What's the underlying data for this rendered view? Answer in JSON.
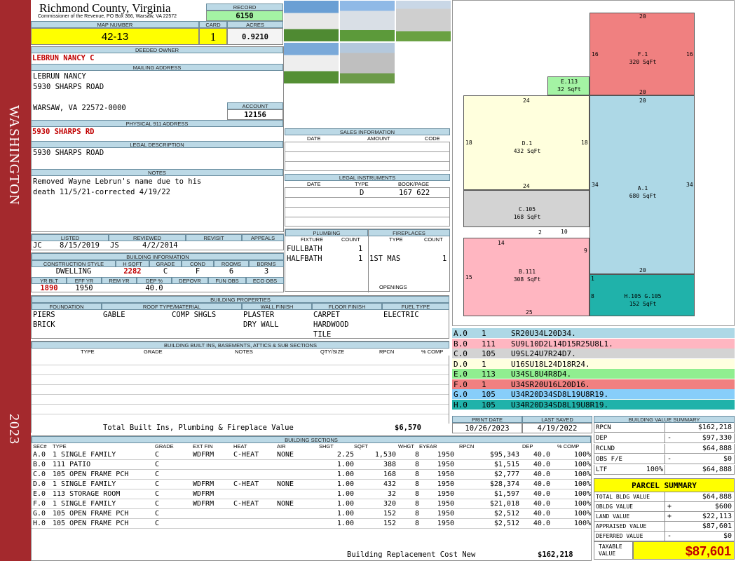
{
  "sidebar": {
    "district": "WASHINGTON",
    "year": "2023"
  },
  "header": {
    "county": "Richmond County, Virginia",
    "commissioner": "Commissioner of the Revenue, PO Box 366, Warsaw, VA 22572",
    "record_label": "RECORD",
    "record": "6150",
    "map_label": "MAP NUMBER",
    "map_number": "42-13",
    "card_label": "CARD",
    "card": "1",
    "acres_label": "ACRES",
    "acres": "0.9210"
  },
  "owner": {
    "deeded_label": "DEEDED OWNER",
    "deeded_owner": "LEBRUN NANCY C",
    "mailing_label": "MAILING ADDRESS",
    "mail_line1": "LEBRUN NANCY",
    "mail_line2": "5930 SHARPS ROAD",
    "mail_line3": "WARSAW, VA 22572-0000",
    "account_label": "ACCOUNT",
    "account": "12156",
    "physical_label": "PHYSICAL 911 ADDRESS",
    "physical": "5930 SHARPS RD",
    "legal_label": "LEGAL DESCRIPTION",
    "legal": "5930 SHARPS ROAD",
    "notes_label": "NOTES",
    "notes1": "Removed Wayne Lebrun's name due to his",
    "notes2": "death 11/5/21-corrected 4/19/22"
  },
  "sales": {
    "label": "SALES INFORMATION",
    "cols": [
      "DATE",
      "AMOUNT",
      "CODE"
    ]
  },
  "legal_instruments": {
    "label": "LEGAL INSTRUMENTS",
    "cols": [
      "DATE",
      "TYPE",
      "BOOK/PAGE"
    ],
    "type": "D",
    "bookpage": "167 622"
  },
  "listing": {
    "listed_label": "LISTED",
    "reviewed_label": "REVIEWED",
    "revisit_label": "REVISIT",
    "appeals_label": "APPEALS",
    "listed_by": "JC",
    "listed_date": "8/15/2019",
    "reviewed_by": "JS",
    "reviewed_date": "4/2/2014"
  },
  "building_info": {
    "label": "BUILDING INFORMATION",
    "cols": [
      "CONSTRUCTION STYLE",
      "H SQFT",
      "GRADE",
      "COND",
      "ROOMS",
      "BDRMS"
    ],
    "style": "DWELLING",
    "hsqft": "2282",
    "grade": "C",
    "cond": "F",
    "rooms": "6",
    "bdrms": "3",
    "cols2": [
      "YR BLT",
      "EFF YR",
      "REM YR",
      "DEP %",
      "DEPOVR",
      "FUN OBS",
      "ECO OBS"
    ],
    "yr_blt": "1890",
    "eff_yr": "1950",
    "dep": "40.0"
  },
  "plumbing": {
    "label": "PLUMBING",
    "cols": [
      "FIXTURE",
      "COUNT"
    ],
    "rows": [
      [
        "FULLBATH",
        "1"
      ],
      [
        "HALFBATH",
        "1"
      ]
    ]
  },
  "fireplaces": {
    "label": "FIREPLACES",
    "cols": [
      "TYPE",
      "COUNT"
    ],
    "rows": [
      [
        "1ST MAS",
        "1"
      ]
    ],
    "openings_label": "OPENINGS"
  },
  "properties": {
    "label": "BUILDING PROPERTIES",
    "foundation_label": "FOUNDATION",
    "roof_label": "ROOF TYPE/MATERIAL",
    "wall_label": "WALL FINISH",
    "floor_label": "FLOOR FINISH",
    "fuel_label": "FUEL TYPE",
    "foundation": [
      "PIERS",
      "BRICK"
    ],
    "roof_type": "GABLE",
    "roof_mat": "COMP SHGLS",
    "wall": [
      "PLASTER",
      "DRY WALL"
    ],
    "floor": [
      "CARPET",
      "HARDWOOD",
      "TILE"
    ],
    "fuel": "ELECTRIC"
  },
  "builtins": {
    "label": "BUILDING BUILT INS, BASEMENTS, ATTICS & SUB SECTIONS",
    "cols": [
      "TYPE",
      "GRADE",
      "NOTES",
      "QTY/SIZE",
      "RPCN",
      "% COMP"
    ],
    "total_label": "Total Built Ins, Plumbing & Fireplace Value",
    "total": "$6,570"
  },
  "print": {
    "print_label": "PRINT DATE",
    "saved_label": "LAST SAVED",
    "print_date": "10/26/2023",
    "last_saved": "4/19/2022"
  },
  "sketch": {
    "segments": [
      {
        "id": "F.1",
        "area": "320 SqFt",
        "color": "#f08080"
      },
      {
        "id": "E.113",
        "area": "32 SqFt",
        "color": "#a4f3a4"
      },
      {
        "id": "D.1",
        "area": "432 SqFt",
        "color": "#ffffdd"
      },
      {
        "id": "A.1",
        "area": "680 SqFt",
        "color": "#add8e6"
      },
      {
        "id": "C.105",
        "area": "168 SqFt",
        "color": "#d3d3d3"
      },
      {
        "id": "B.111",
        "area": "308 SqFt",
        "color": "#ffb6c1"
      },
      {
        "id": "H.105 G.105",
        "area": "152 SqFt",
        "color": "#20b2aa"
      }
    ],
    "dims": [
      "20",
      "16",
      "16",
      "20",
      "24",
      "20",
      "18",
      "18",
      "24",
      "34",
      "34",
      "2",
      "10",
      "14",
      "9",
      "20",
      "15",
      "1",
      "8",
      "25"
    ]
  },
  "codes": [
    {
      "sec": "A.0",
      "code": "1",
      "path": "SR20U34L20D34.",
      "color": "#add8e6"
    },
    {
      "sec": "B.0",
      "code": "111",
      "path": "SU9L10D2L14D15R25U8L1.",
      "color": "#ffb6c1"
    },
    {
      "sec": "C.0",
      "code": "105",
      "path": "U9SL24U7R24D7.",
      "color": "#d3d3d3"
    },
    {
      "sec": "D.0",
      "code": "1",
      "path": "U16SU18L24D18R24.",
      "color": "#ffffe0"
    },
    {
      "sec": "E.0",
      "code": "113",
      "path": "U34SL8U4R8D4.",
      "color": "#90ee90"
    },
    {
      "sec": "F.0",
      "code": "1",
      "path": "U34SR20U16L20D16.",
      "color": "#f08080"
    },
    {
      "sec": "G.0",
      "code": "105",
      "path": "U34R20D34SD8L19U8R19.",
      "color": "#87cefa"
    },
    {
      "sec": "H.0",
      "code": "105",
      "path": "U34R20D34SD8L19U8R19.",
      "color": "#20b2aa"
    }
  ],
  "sections": {
    "label": "BUILDING SECTIONS",
    "cols": [
      "SEC#",
      "TYPE",
      "GRADE",
      "EXT FIN",
      "HEAT",
      "AIR",
      "SHGT",
      "SQFT",
      "WHGT",
      "EYEAR",
      "RPCN",
      "DEP",
      "% COMP"
    ],
    "rows": [
      [
        "A.0",
        "1 SINGLE FAMILY",
        "C",
        "WDFRM",
        "C-HEAT",
        "NONE",
        "2.25",
        "1,530",
        "8",
        "1950",
        "$95,343",
        "40.0",
        "100%"
      ],
      [
        "B.0",
        "111 PATIO",
        "C",
        "",
        "",
        "",
        "1.00",
        "388",
        "8",
        "1950",
        "$1,515",
        "40.0",
        "100%"
      ],
      [
        "C.0",
        "105 OPEN FRAME PCH",
        "C",
        "",
        "",
        "",
        "1.00",
        "168",
        "8",
        "1950",
        "$2,777",
        "40.0",
        "100%"
      ],
      [
        "D.0",
        "1 SINGLE FAMILY",
        "C",
        "WDFRM",
        "C-HEAT",
        "NONE",
        "1.00",
        "432",
        "8",
        "1950",
        "$28,374",
        "40.0",
        "100%"
      ],
      [
        "E.0",
        "113 STORAGE ROOM",
        "C",
        "WDFRM",
        "",
        "",
        "1.00",
        "32",
        "8",
        "1950",
        "$1,597",
        "40.0",
        "100%"
      ],
      [
        "F.0",
        "1 SINGLE FAMILY",
        "C",
        "WDFRM",
        "C-HEAT",
        "NONE",
        "1.00",
        "320",
        "8",
        "1950",
        "$21,018",
        "40.0",
        "100%"
      ],
      [
        "G.0",
        "105 OPEN FRAME PCH",
        "C",
        "",
        "",
        "",
        "1.00",
        "152",
        "8",
        "1950",
        "$2,512",
        "40.0",
        "100%"
      ],
      [
        "H.0",
        "105 OPEN FRAME PCH",
        "C",
        "",
        "",
        "",
        "1.00",
        "152",
        "8",
        "1950",
        "$2,512",
        "40.0",
        "100%"
      ]
    ],
    "replacement_label": "Building Replacement Cost New",
    "replacement": "$162,218"
  },
  "value_summary": {
    "label": "BUILDING VALUE SUMMARY",
    "rows": [
      {
        "k": "RPCN",
        "s": "",
        "v": "$162,218"
      },
      {
        "k": "DEP",
        "s": "-",
        "v": "$97,330"
      },
      {
        "k": "RCLND",
        "s": "",
        "v": "$64,888"
      },
      {
        "k": "OBS F/E",
        "s": "-",
        "v": "$0"
      },
      {
        "k": "LTF",
        "pct": "100%",
        "s": "",
        "v": "$64,888"
      }
    ]
  },
  "parcel": {
    "label": "PARCEL SUMMARY",
    "rows": [
      {
        "k": "TOTAL BLDG VALUE",
        "s": "",
        "v": "$64,888"
      },
      {
        "k": "OBLDG VALUE",
        "s": "+",
        "v": "$600"
      },
      {
        "k": "LAND VALUE",
        "s": "+",
        "v": "$22,113"
      },
      {
        "k": "APPRAISED VALUE",
        "s": "",
        "v": "$87,601"
      },
      {
        "k": "DEFERRED VALUE",
        "s": "-",
        "v": "$0"
      }
    ],
    "taxable_label1": "TAXABLE",
    "taxable_label2": "VALUE",
    "taxable": "$87,601"
  }
}
